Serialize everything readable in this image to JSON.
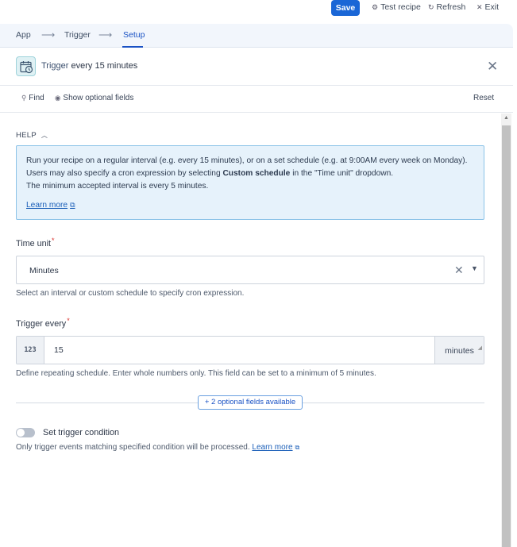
{
  "topbar": {
    "save_label": "Save",
    "test_label": "Test recipe",
    "refresh_label": "Refresh",
    "exit_label": "Exit"
  },
  "steps": [
    {
      "label": "App"
    },
    {
      "label": "Trigger"
    },
    {
      "label": "Setup",
      "active": true
    }
  ],
  "header": {
    "title_highlight": "Trigger",
    "title_rest": " every 15 minutes"
  },
  "toolbar": {
    "find_label": "Find",
    "optional_label": "Show optional fields",
    "reset_label": "Reset"
  },
  "help": {
    "label": "HELP",
    "line1": "Run your recipe on a regular interval (e.g. every 15 minutes), or on a set schedule (e.g. at 9:00AM every week on Monday).",
    "line2_pre": "Users may also specify a cron expression by selecting ",
    "line2_bold": "Custom schedule",
    "line2_post": " in the \"Time unit\" dropdown.",
    "line3": "The minimum accepted interval is every 5 minutes.",
    "link": "Learn more"
  },
  "time_unit": {
    "label": "Time unit",
    "value": "Minutes",
    "hint": "Select an interval or custom schedule to specify cron expression."
  },
  "trigger_every": {
    "label": "Trigger every",
    "prefix": "123",
    "value": "15",
    "suffix": "minutes",
    "hint": "Define repeating schedule. Enter whole numbers only. This field can be set to a minimum of 5 minutes."
  },
  "optional": {
    "label": "+ 2 optional fields available"
  },
  "condition": {
    "label": "Set trigger condition",
    "enabled": false,
    "hint": "Only trigger events matching specified condition will be processed.",
    "link": "Learn more"
  },
  "colors": {
    "accent": "#1a66d6",
    "help_bg": "#e6f2fb",
    "required": "#d9302b"
  }
}
